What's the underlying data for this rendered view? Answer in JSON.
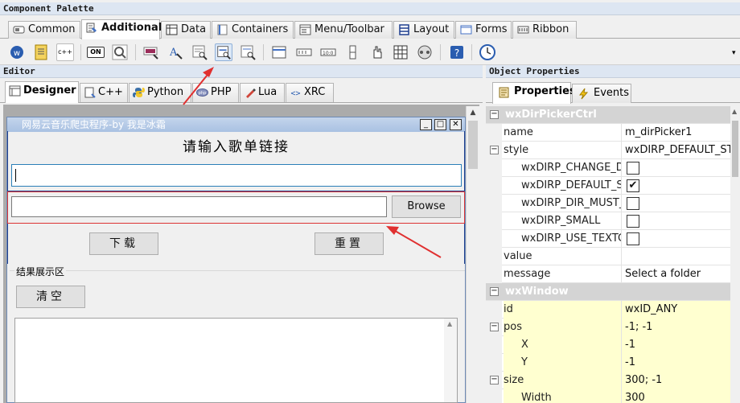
{
  "palette": {
    "title": "Component Palette",
    "tabs": [
      {
        "label": "Common",
        "icon": "common-icon"
      },
      {
        "label": "Additional",
        "icon": "additional-icon"
      },
      {
        "label": "Data",
        "icon": "data-icon"
      },
      {
        "label": "Containers",
        "icon": "containers-icon"
      },
      {
        "label": "Menu/Toolbar",
        "icon": "menu-toolbar-icon"
      },
      {
        "label": "Layout",
        "icon": "layout-icon"
      },
      {
        "label": "Forms",
        "icon": "forms-icon"
      },
      {
        "label": "Ribbon",
        "icon": "ribbon-icon"
      }
    ],
    "active_tab": "Additional",
    "toolbar_small_labels": {
      "cpp": "c++",
      "on": "ON"
    }
  },
  "editor": {
    "title": "Editor",
    "tabs": [
      {
        "label": "Designer",
        "icon": "designer-icon"
      },
      {
        "label": "C++",
        "icon": "cpp-icon"
      },
      {
        "label": "Python",
        "icon": "python-icon"
      },
      {
        "label": "PHP",
        "icon": "php-icon"
      },
      {
        "label": "Lua",
        "icon": "lua-icon"
      },
      {
        "label": "XRC",
        "icon": "xrc-icon"
      }
    ],
    "active_tab": "Designer"
  },
  "dialog": {
    "title": "网易云音乐爬虫程序-by 我是冰霜",
    "heading": "请输入歌单链接",
    "url_value": "",
    "dir_value": "",
    "browse_label": "Browse",
    "download_label": "下载",
    "reset_label": "重置",
    "result_group_label": "结果展示区",
    "clear_label": "清空"
  },
  "properties": {
    "title": "Object Properties",
    "tabs": [
      {
        "label": "Properties",
        "icon": "properties-icon"
      },
      {
        "label": "Events",
        "icon": "events-icon"
      }
    ],
    "rows": [
      {
        "kind": "category",
        "name": "wxDirPickerCtrl"
      },
      {
        "kind": "prop",
        "name": "name",
        "value": "m_dirPicker1"
      },
      {
        "kind": "prop",
        "name": "style",
        "value": "wxDIRP_DEFAULT_STYLE",
        "expandable": true
      },
      {
        "kind": "flag",
        "name": "wxDIRP_CHANGE_DIR",
        "checked": false
      },
      {
        "kind": "flag",
        "name": "wxDIRP_DEFAULT_STYLE",
        "checked": true
      },
      {
        "kind": "flag",
        "name": "wxDIRP_DIR_MUST_EXIST",
        "checked": false
      },
      {
        "kind": "flag",
        "name": "wxDIRP_SMALL",
        "checked": false
      },
      {
        "kind": "flag",
        "name": "wxDIRP_USE_TEXTCTRL",
        "checked": false
      },
      {
        "kind": "prop",
        "name": "value",
        "value": ""
      },
      {
        "kind": "prop",
        "name": "message",
        "value": "Select a folder"
      },
      {
        "kind": "category",
        "name": "wxWindow"
      },
      {
        "kind": "prop",
        "name": "id",
        "value": "wxID_ANY",
        "highlight": true
      },
      {
        "kind": "prop",
        "name": "pos",
        "value": "-1; -1",
        "expandable": true,
        "highlight": true
      },
      {
        "kind": "sub",
        "name": "X",
        "value": "-1",
        "highlight": true
      },
      {
        "kind": "sub",
        "name": "Y",
        "value": "-1",
        "highlight": true
      },
      {
        "kind": "prop",
        "name": "size",
        "value": "300; -1",
        "expandable": true,
        "highlight": true
      },
      {
        "kind": "sub",
        "name": "Width",
        "value": "300",
        "highlight": true
      }
    ],
    "checkmark": "✔",
    "expand_symbol": "⊟"
  },
  "colors": {
    "annotation_red": "#e03030",
    "highlight_yellow": "#ffffd0",
    "category_gray": "#d4d4d4"
  }
}
